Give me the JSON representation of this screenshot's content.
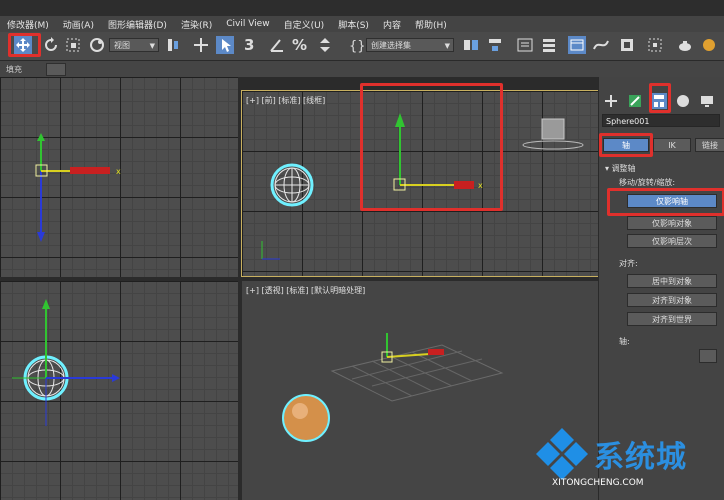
{
  "menubar": {
    "items": [
      "修改器(M)",
      "动画(A)",
      "图形编辑器(D)",
      "渲染(R)",
      "Civil View",
      "自定义(U)",
      "脚本(S)",
      "内容",
      "帮助(H)"
    ]
  },
  "toolbar": {
    "view_dropdown": "视图",
    "selection_set_dropdown": "创建选择集",
    "snap_label": "3"
  },
  "ribbon": {
    "label": "填充"
  },
  "viewports": {
    "front": {
      "label": "[+] [前] [标准] [线框]"
    },
    "perspective": {
      "label": "[+] [透视] [标准] [默认明暗处理]"
    }
  },
  "command_panel": {
    "object_name": "Sphere001",
    "tabs": {
      "pivot": "轴",
      "ik": "IK",
      "link": "链接"
    },
    "adjust_pivot": {
      "title": "调整轴",
      "subtitle": "移动/旋转/缩放:",
      "buttons": [
        "仅影响轴",
        "仅影响对象",
        "仅影响层次"
      ]
    },
    "align": {
      "title": "对齐:",
      "buttons": [
        "居中到对象",
        "对齐到对象",
        "对齐到世界"
      ]
    },
    "pivot_section": {
      "title": "轴:"
    }
  },
  "watermark": {
    "text": "系统城",
    "url": "XITONGCHENG.COM"
  },
  "colors": {
    "highlight": "#e0302c",
    "active_button": "#5c89c7",
    "selection_cyan": "#6ff0ff"
  }
}
